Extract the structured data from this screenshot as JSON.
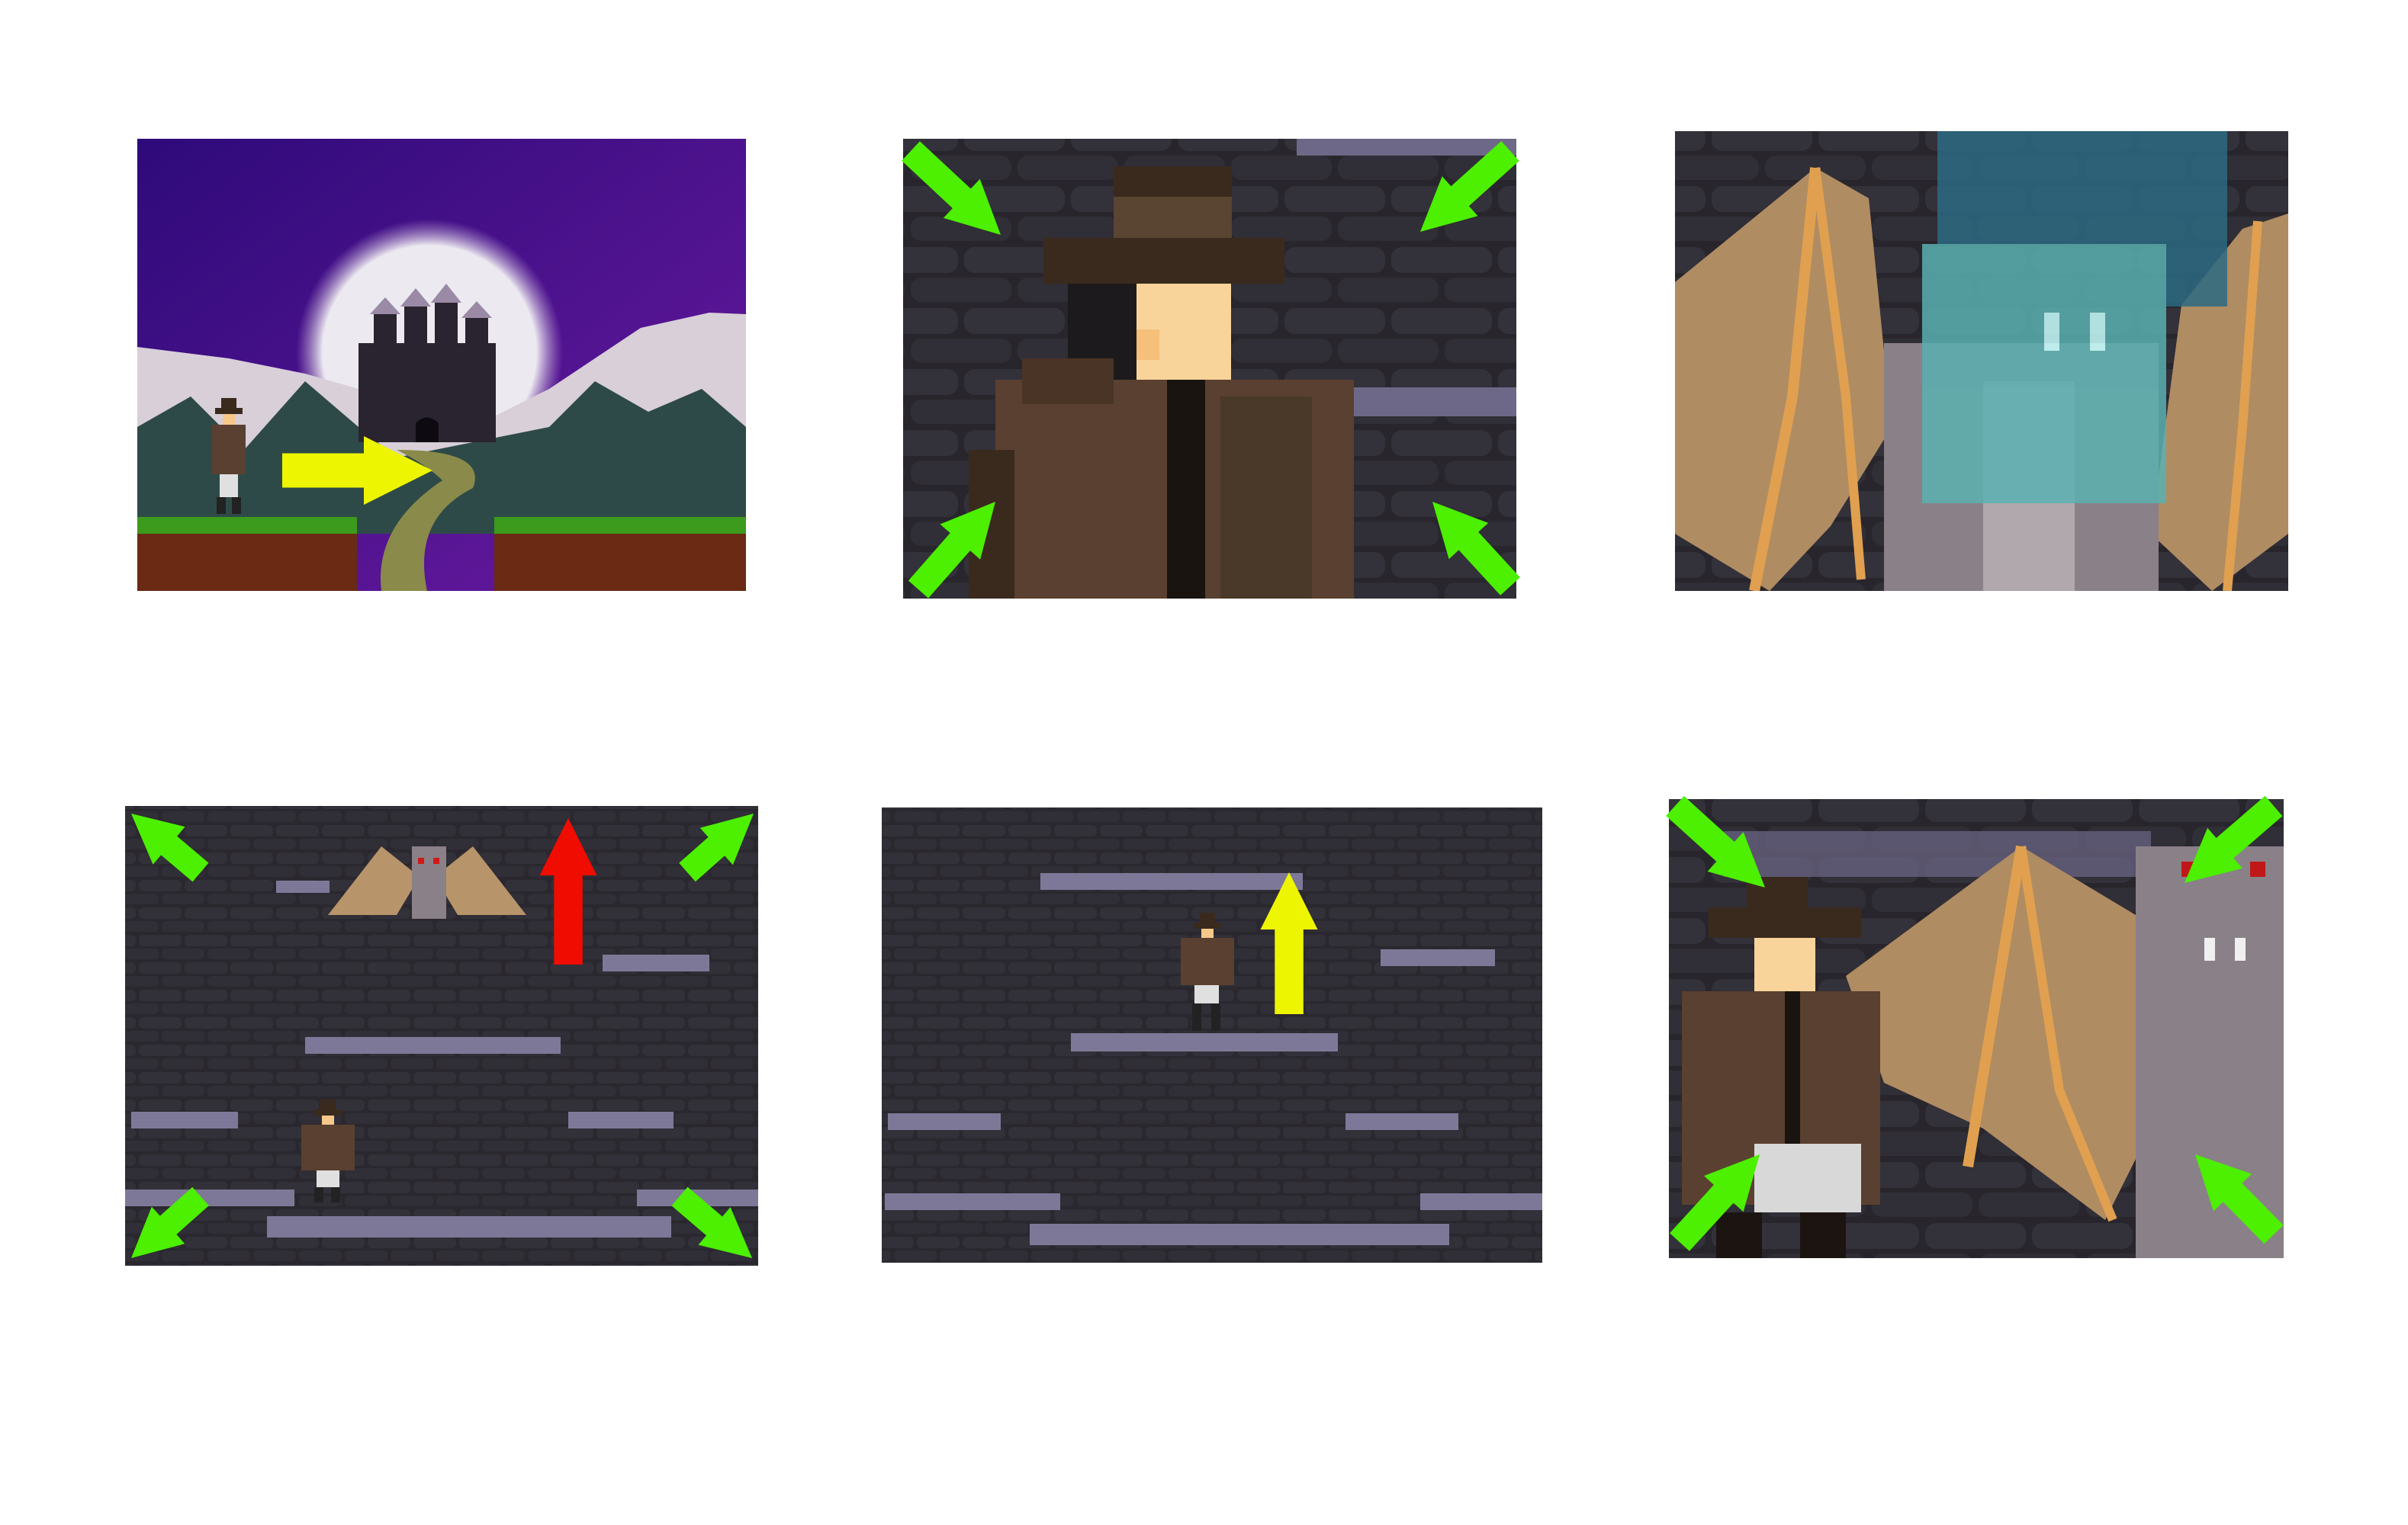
{
  "storyboard": {
    "background": "#ffffff",
    "panels": [
      {
        "id": "castle-intro",
        "arrows": [
          {
            "icon": "arrow-right-icon",
            "color": "#eef500"
          }
        ]
      },
      {
        "id": "hero-closeup",
        "arrows": [
          {
            "icon": "arrow-down-right-icon",
            "color": "#4cf000"
          },
          {
            "icon": "arrow-down-left-icon",
            "color": "#4cf000"
          },
          {
            "icon": "arrow-up-right-icon",
            "color": "#4cf000"
          },
          {
            "icon": "arrow-up-left-icon",
            "color": "#4cf000"
          }
        ]
      },
      {
        "id": "bat-ghost-closeup",
        "arrows": []
      },
      {
        "id": "dungeon-bat-appears",
        "arrows": [
          {
            "icon": "arrow-up-icon",
            "color": "#f00c00"
          },
          {
            "icon": "arrow-up-left-icon",
            "color": "#4cf000"
          },
          {
            "icon": "arrow-up-right-icon",
            "color": "#4cf000"
          },
          {
            "icon": "arrow-down-left-icon",
            "color": "#4cf000"
          },
          {
            "icon": "arrow-down-right-icon",
            "color": "#4cf000"
          }
        ]
      },
      {
        "id": "dungeon-hero-jump",
        "arrows": [
          {
            "icon": "arrow-up-icon",
            "color": "#eef500"
          }
        ]
      },
      {
        "id": "hero-meets-bat",
        "arrows": [
          {
            "icon": "arrow-down-right-icon",
            "color": "#4cf000"
          },
          {
            "icon": "arrow-down-left-icon",
            "color": "#4cf000"
          },
          {
            "icon": "arrow-up-right-icon",
            "color": "#4cf000"
          },
          {
            "icon": "arrow-up-left-icon",
            "color": "#4cf000"
          }
        ]
      }
    ],
    "colors": {
      "sky_top": "#2e0a7a",
      "sky_bottom": "#6a1aa0",
      "moon": "#e8e4ee",
      "brick_bg": "#2a282e",
      "platform": "#7e7898",
      "grass": "#3c9a1c",
      "dirt": "#6a2a14",
      "coat": "#5a4030",
      "hat": "#3a2a1e",
      "skin": "#f6c88a",
      "bat_wing": "#b8946a",
      "bat_bone": "#e0a050",
      "gargoyle": "#8a8088",
      "ghost": "#5ab0b0"
    }
  }
}
